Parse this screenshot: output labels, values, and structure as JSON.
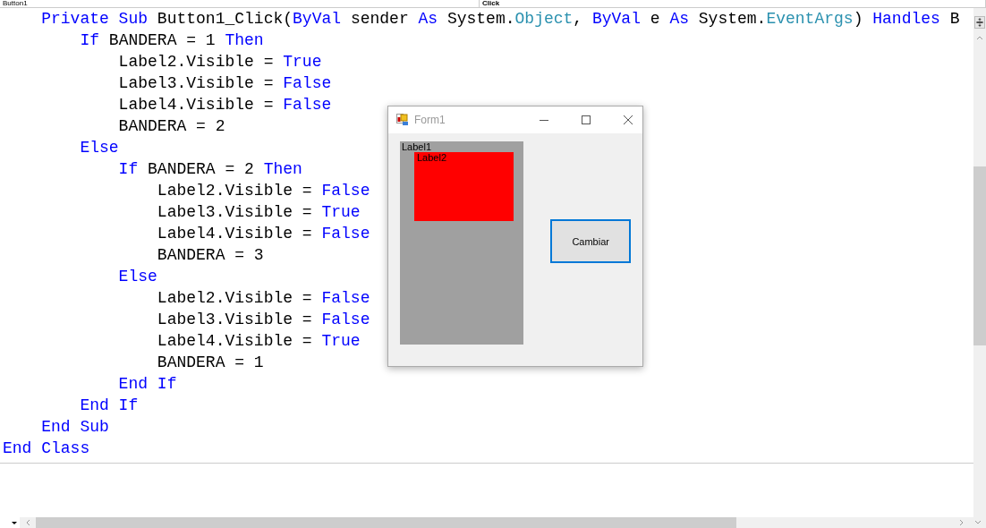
{
  "navigation_bar": {
    "object_dropdown": "Button1",
    "event_dropdown": "Click"
  },
  "code": [
    {
      "tokens": [
        {
          "text": "    Private Sub",
          "kind": "keyword"
        },
        {
          "text": " Button1_Click(",
          "kind": "plain"
        },
        {
          "text": "ByVal",
          "kind": "keyword"
        },
        {
          "text": " sender ",
          "kind": "plain"
        },
        {
          "text": "As",
          "kind": "keyword"
        },
        {
          "text": " System.",
          "kind": "plain"
        },
        {
          "text": "Object",
          "kind": "type"
        },
        {
          "text": ", ",
          "kind": "plain"
        },
        {
          "text": "ByVal",
          "kind": "keyword"
        },
        {
          "text": " e ",
          "kind": "plain"
        },
        {
          "text": "As",
          "kind": "keyword"
        },
        {
          "text": " System.",
          "kind": "plain"
        },
        {
          "text": "EventArgs",
          "kind": "type"
        },
        {
          "text": ") ",
          "kind": "plain"
        },
        {
          "text": "Handles",
          "kind": "keyword"
        },
        {
          "text": " B",
          "kind": "plain"
        }
      ]
    },
    {
      "tokens": [
        {
          "text": "        If",
          "kind": "keyword"
        },
        {
          "text": " BANDERA = 1 ",
          "kind": "plain"
        },
        {
          "text": "Then",
          "kind": "keyword"
        }
      ]
    },
    {
      "tokens": [
        {
          "text": "            Label2.Visible = ",
          "kind": "plain"
        },
        {
          "text": "True",
          "kind": "keyword"
        }
      ]
    },
    {
      "tokens": [
        {
          "text": "            Label3.Visible = ",
          "kind": "plain"
        },
        {
          "text": "False",
          "kind": "keyword"
        }
      ]
    },
    {
      "tokens": [
        {
          "text": "            Label4.Visible = ",
          "kind": "plain"
        },
        {
          "text": "False",
          "kind": "keyword"
        }
      ]
    },
    {
      "tokens": [
        {
          "text": "            BANDERA = 2",
          "kind": "plain"
        }
      ]
    },
    {
      "tokens": [
        {
          "text": "        Else",
          "kind": "keyword"
        }
      ]
    },
    {
      "tokens": [
        {
          "text": "            If",
          "kind": "keyword"
        },
        {
          "text": " BANDERA = 2 ",
          "kind": "plain"
        },
        {
          "text": "Then",
          "kind": "keyword"
        }
      ]
    },
    {
      "tokens": [
        {
          "text": "                Label2.Visible = ",
          "kind": "plain"
        },
        {
          "text": "False",
          "kind": "keyword"
        }
      ]
    },
    {
      "tokens": [
        {
          "text": "                Label3.Visible = ",
          "kind": "plain"
        },
        {
          "text": "True",
          "kind": "keyword"
        }
      ]
    },
    {
      "tokens": [
        {
          "text": "                Label4.Visible = ",
          "kind": "plain"
        },
        {
          "text": "False",
          "kind": "keyword"
        }
      ]
    },
    {
      "tokens": [
        {
          "text": "                BANDERA = 3",
          "kind": "plain"
        }
      ]
    },
    {
      "tokens": [
        {
          "text": "            Else",
          "kind": "keyword"
        }
      ]
    },
    {
      "tokens": [
        {
          "text": "                Label2.Visible = ",
          "kind": "plain"
        },
        {
          "text": "False",
          "kind": "keyword"
        }
      ]
    },
    {
      "tokens": [
        {
          "text": "                Label3.Visible = ",
          "kind": "plain"
        },
        {
          "text": "False",
          "kind": "keyword"
        }
      ]
    },
    {
      "tokens": [
        {
          "text": "                Label4.Visible = ",
          "kind": "plain"
        },
        {
          "text": "True",
          "kind": "keyword"
        }
      ]
    },
    {
      "tokens": [
        {
          "text": "                BANDERA = 1",
          "kind": "plain"
        }
      ]
    },
    {
      "tokens": [
        {
          "text": "            End If",
          "kind": "keyword"
        }
      ]
    },
    {
      "tokens": [
        {
          "text": "        End If",
          "kind": "keyword"
        }
      ]
    },
    {
      "tokens": [
        {
          "text": "    End Sub",
          "kind": "keyword"
        }
      ]
    },
    {
      "tokens": [
        {
          "text": "End Class",
          "kind": "keyword"
        }
      ]
    }
  ],
  "form_window": {
    "title": "Form1",
    "panel_label": "Label1",
    "red_label": "Label2",
    "button": "Cambiar"
  }
}
